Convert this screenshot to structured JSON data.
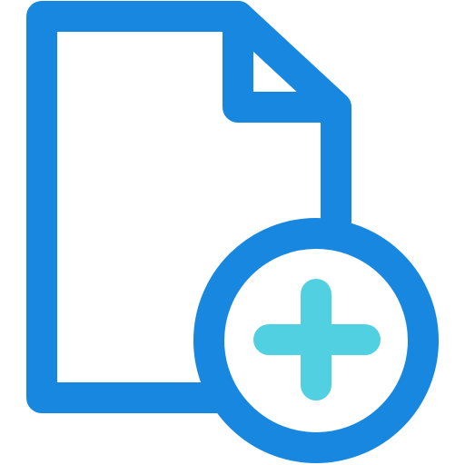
{
  "icon": {
    "name": "add-file-icon",
    "colors": {
      "outline": "#1787E0",
      "plus": "#50D0E0",
      "fill": "#FFFFFF"
    }
  }
}
